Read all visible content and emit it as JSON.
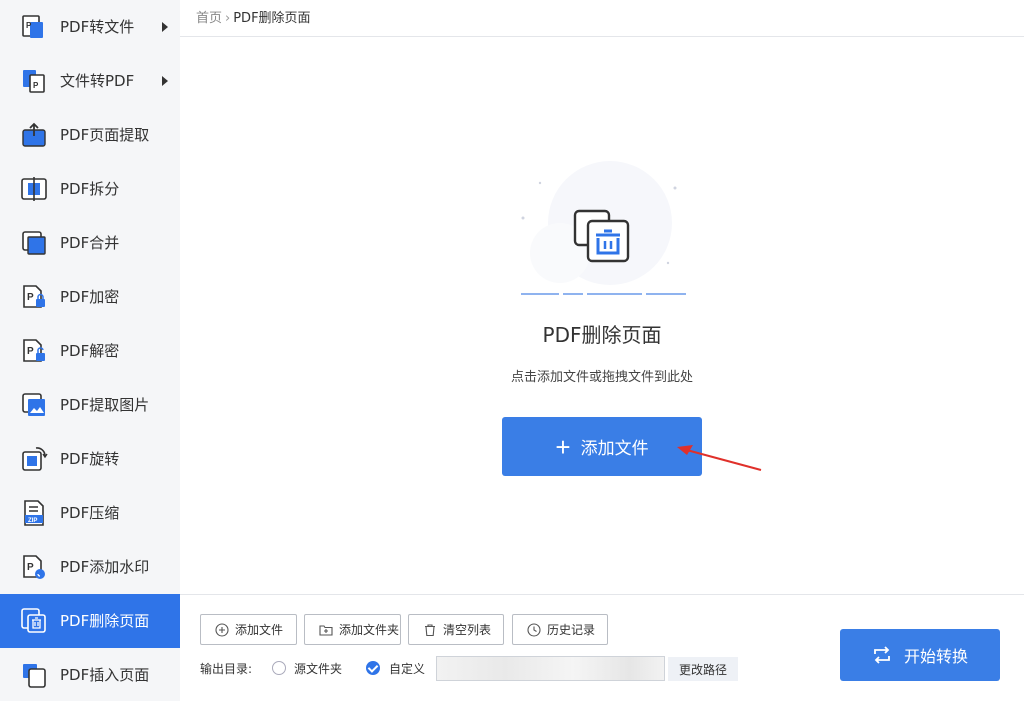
{
  "sidebar": {
    "items": [
      {
        "label": "PDF转文件",
        "icon": "pdf-to-file-icon",
        "has_submenu": true
      },
      {
        "label": "文件转PDF",
        "icon": "file-to-pdf-icon",
        "has_submenu": true
      },
      {
        "label": "PDF页面提取",
        "icon": "page-extract-icon"
      },
      {
        "label": "PDF拆分",
        "icon": "split-icon"
      },
      {
        "label": "PDF合并",
        "icon": "merge-icon"
      },
      {
        "label": "PDF加密",
        "icon": "encrypt-icon"
      },
      {
        "label": "PDF解密",
        "icon": "decrypt-icon"
      },
      {
        "label": "PDF提取图片",
        "icon": "image-extract-icon"
      },
      {
        "label": "PDF旋转",
        "icon": "rotate-icon"
      },
      {
        "label": "PDF压缩",
        "icon": "zip-icon"
      },
      {
        "label": "PDF添加水印",
        "icon": "watermark-icon"
      },
      {
        "label": "PDF删除页面",
        "icon": "delete-page-icon",
        "active": true
      },
      {
        "label": "PDF插入页面",
        "icon": "insert-page-icon"
      }
    ]
  },
  "breadcrumb": {
    "home": "首页",
    "separator": "›",
    "current": "PDF删除页面"
  },
  "main": {
    "title": "PDF删除页面",
    "hint": "点击添加文件或拖拽文件到此处",
    "add_button": "添加文件",
    "add_button_icon": "plus-icon"
  },
  "toolbar": {
    "add_file": "添加文件",
    "add_folder": "添加文件夹",
    "clear_list": "清空列表",
    "history": "历史记录"
  },
  "output": {
    "label": "输出目录:",
    "option_source": "源文件夹",
    "option_custom": "自定义",
    "selected": "自定义",
    "path_value": "",
    "change_path": "更改路径"
  },
  "start_button": "开始转换",
  "colors": {
    "accent": "#2f74e8",
    "button": "#3a7ee6",
    "sidebar_bg": "#f5f6f8",
    "arrow": "#e0302a"
  }
}
